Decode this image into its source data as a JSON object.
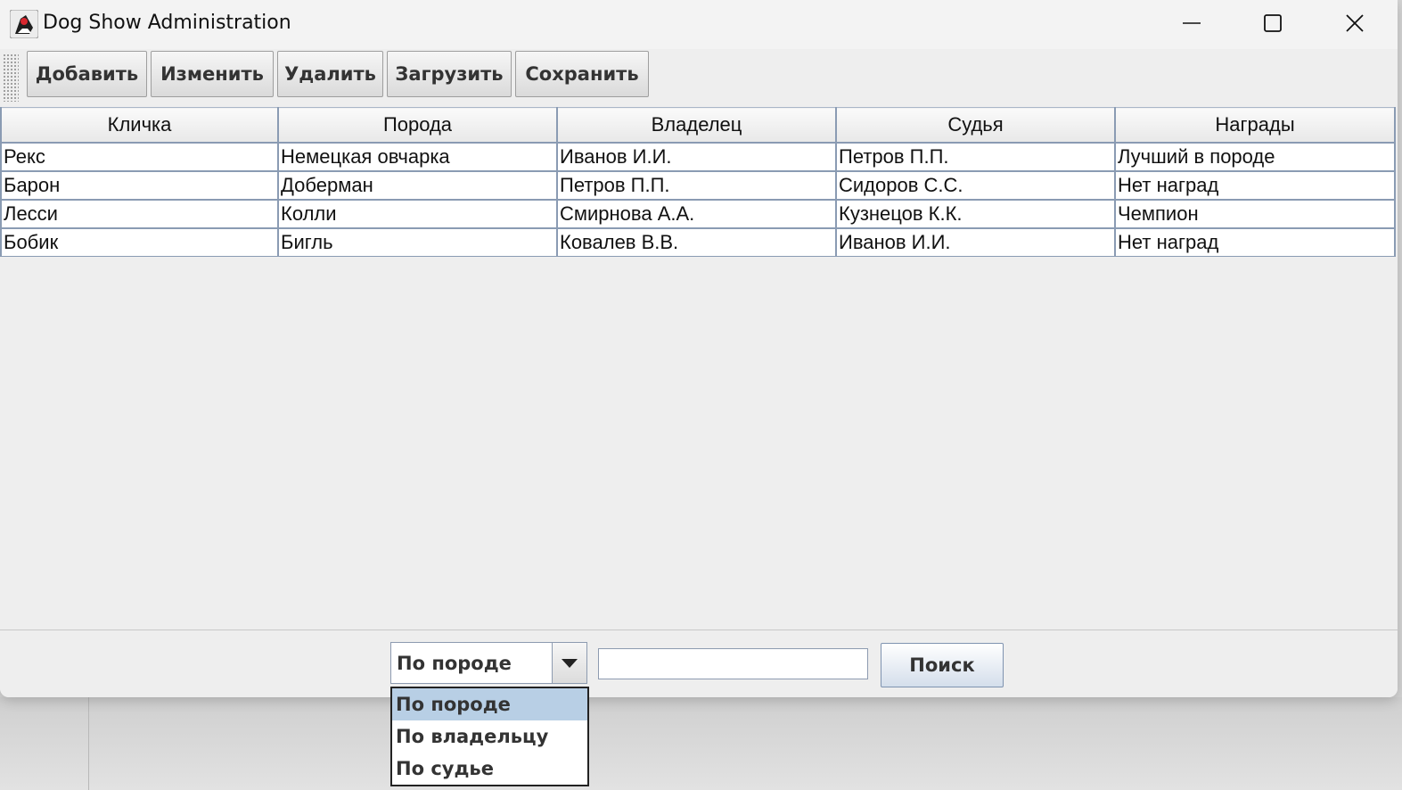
{
  "window": {
    "title": "Dog Show Administration",
    "icon": "java-duke-icon"
  },
  "toolbar": {
    "buttons": [
      {
        "label": "Добавить"
      },
      {
        "label": "Изменить"
      },
      {
        "label": "Удалить"
      },
      {
        "label": "Загрузить"
      },
      {
        "label": "Сохранить"
      }
    ]
  },
  "table": {
    "columns": [
      "Кличка",
      "Порода",
      "Владелец",
      "Судья",
      "Награды"
    ],
    "rows": [
      [
        "Рекс",
        "Немецкая овчарка",
        "Иванов И.И.",
        "Петров П.П.",
        "Лучший в породе"
      ],
      [
        "Барон",
        "Доберман",
        "Петров П.П.",
        "Сидоров С.С.",
        "Нет наград"
      ],
      [
        "Лесси",
        "Колли",
        "Смирнова А.А.",
        "Кузнецов К.К.",
        "Чемпион"
      ],
      [
        "Бобик",
        "Бигль",
        "Ковалев В.В.",
        "Иванов И.И.",
        "Нет наград"
      ]
    ]
  },
  "search": {
    "filter_selected": "По породе",
    "filter_options": [
      "По породе",
      "По владельцу",
      "По судье"
    ],
    "query_value": "",
    "button_label": "Поиск"
  },
  "colors": {
    "grid_border": "#8a9bb3",
    "selected_option": "#b8cfe5",
    "window_bg": "#eeeeee"
  }
}
